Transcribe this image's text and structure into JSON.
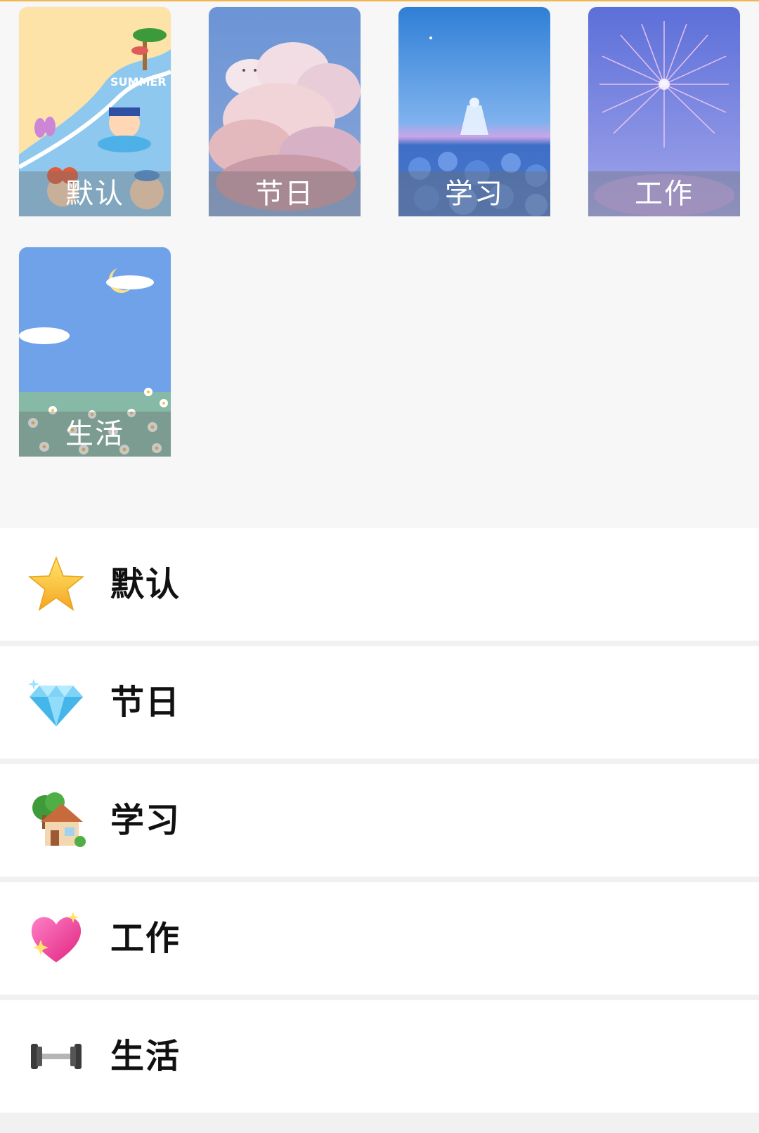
{
  "colors": {
    "page_background": "#f7f7f7",
    "list_background": "#ffffff",
    "divider": "#f1f1f1",
    "caption_text": "#ffffff",
    "label_text": "#111111",
    "top_accent": "#f2b64e"
  },
  "gallery": {
    "cards": [
      {
        "label": "默认",
        "theme": "summer-beach-cartoon"
      },
      {
        "label": "节日",
        "theme": "pink-clouds-sky"
      },
      {
        "label": "学习",
        "theme": "blue-rose-field-night"
      },
      {
        "label": "工作",
        "theme": "purple-fireworks"
      },
      {
        "label": "生活",
        "theme": "daisy-meadow-moon"
      }
    ]
  },
  "list": {
    "items": [
      {
        "label": "默认",
        "icon": "star-icon"
      },
      {
        "label": "节日",
        "icon": "gem-icon"
      },
      {
        "label": "学习",
        "icon": "house-with-tree-icon"
      },
      {
        "label": "工作",
        "icon": "sparkling-heart-icon"
      },
      {
        "label": "生活",
        "icon": "dumbbell-icon"
      }
    ]
  }
}
